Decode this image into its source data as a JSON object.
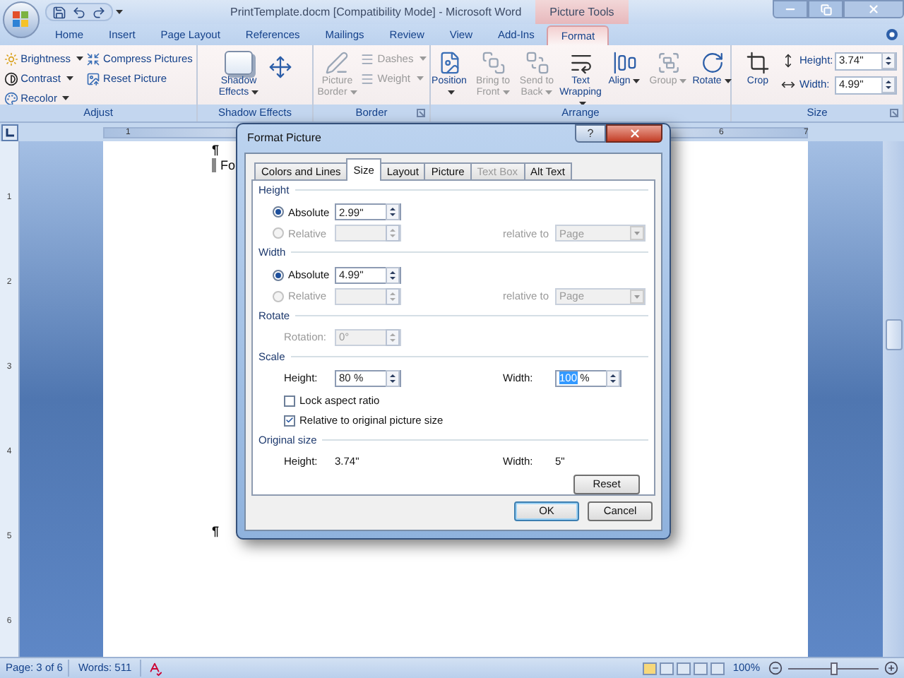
{
  "window": {
    "title": "PrintTemplate.docm [Compatibility Mode] - Microsoft Word",
    "context_label": "Picture Tools"
  },
  "tabs": [
    {
      "label": "Home",
      "selected": false
    },
    {
      "label": "Insert",
      "selected": false
    },
    {
      "label": "Page Layout",
      "selected": false
    },
    {
      "label": "References",
      "selected": false
    },
    {
      "label": "Mailings",
      "selected": false
    },
    {
      "label": "Review",
      "selected": false
    },
    {
      "label": "View",
      "selected": false
    },
    {
      "label": "Add-Ins",
      "selected": false
    },
    {
      "label": "Format",
      "selected": true
    }
  ],
  "ribbon": [
    {
      "label": "Adjust",
      "launcher": false,
      "columns": [
        [
          {
            "kind": "small",
            "label": "Brightness",
            "menu": true,
            "disabled": false
          },
          {
            "kind": "small",
            "label": "Contrast",
            "menu": true,
            "disabled": false
          },
          {
            "kind": "small",
            "label": "Recolor",
            "menu": true,
            "disabled": false
          }
        ],
        [
          {
            "kind": "small",
            "label": "Compress Pictures",
            "menu": false,
            "disabled": false
          },
          {
            "kind": "small",
            "label": "Reset Picture",
            "menu": false,
            "disabled": false
          }
        ]
      ]
    },
    {
      "label": "Shadow Effects",
      "launcher": false,
      "columns": [
        [
          {
            "kind": "large",
            "label": "Shadow Effects",
            "menu": true,
            "disabled": false
          }
        ],
        [
          {
            "kind": "nudge"
          }
        ]
      ]
    },
    {
      "label": "Border",
      "launcher": true,
      "columns": [
        [
          {
            "kind": "large",
            "label": "Picture Border",
            "menu": true,
            "disabled": true
          }
        ],
        [
          {
            "kind": "small",
            "label": "Dashes",
            "menu": true,
            "disabled": true
          },
          {
            "kind": "small",
            "label": "Weight",
            "menu": true,
            "disabled": true
          }
        ]
      ]
    },
    {
      "label": "Arrange",
      "launcher": false,
      "columns": [
        [
          {
            "kind": "large",
            "label": "Position",
            "menu": true,
            "disabled": false
          }
        ],
        [
          {
            "kind": "large",
            "label": "Bring to Front",
            "menu": true,
            "disabled": true
          }
        ],
        [
          {
            "kind": "large",
            "label": "Send to Back",
            "menu": true,
            "disabled": true
          }
        ],
        [
          {
            "kind": "large",
            "label": "Text Wrapping",
            "menu": true,
            "disabled": false
          }
        ],
        [
          {
            "kind": "large",
            "label": "Align",
            "menu": true,
            "disabled": false
          }
        ],
        [
          {
            "kind": "large",
            "label": "Group",
            "menu": true,
            "disabled": true
          }
        ],
        [
          {
            "kind": "large",
            "label": "Rotate",
            "menu": true,
            "disabled": false
          }
        ]
      ]
    },
    {
      "label": "Size",
      "launcher": true,
      "columns": [
        [
          {
            "kind": "large",
            "label": "Crop",
            "menu": false,
            "disabled": false
          }
        ],
        [
          {
            "kind": "spinner",
            "label": "Height:",
            "value": "3.74\""
          },
          {
            "kind": "spinner",
            "label": "Width:",
            "value": "4.99\""
          }
        ]
      ]
    }
  ],
  "ruler": {
    "horizontal": [
      "1",
      "6",
      "7"
    ],
    "vertical": [
      "1",
      "2",
      "3",
      "4",
      "5",
      "6"
    ]
  },
  "document": {
    "first_mark": "¶",
    "field_text": "Fo",
    "last_mark": "¶"
  },
  "dialog": {
    "title": "Format Picture",
    "help_label": "?",
    "tabs": [
      {
        "label": "Colors and Lines",
        "selected": false,
        "disabled": false
      },
      {
        "label": "Size",
        "selected": true,
        "disabled": false
      },
      {
        "label": "Layout",
        "selected": false,
        "disabled": false
      },
      {
        "label": "Picture",
        "selected": false,
        "disabled": false
      },
      {
        "label": "Text Box",
        "selected": false,
        "disabled": true
      },
      {
        "label": "Alt Text",
        "selected": false,
        "disabled": false
      }
    ],
    "sections": [
      {
        "kind": "size_block",
        "heading": "Height",
        "options": [
          {
            "label": "Absolute",
            "selected": true,
            "disabled": false,
            "value": "2.99\""
          },
          {
            "label": "Relative",
            "selected": false,
            "disabled": true,
            "relative_to": "relative to",
            "dropdown": "Page"
          }
        ]
      },
      {
        "kind": "size_block",
        "heading": "Width",
        "options": [
          {
            "label": "Absolute",
            "selected": true,
            "disabled": false,
            "value": "4.99\""
          },
          {
            "label": "Relative",
            "selected": false,
            "disabled": true,
            "relative_to": "relative to",
            "dropdown": "Page"
          }
        ]
      },
      {
        "kind": "rotate",
        "heading": "Rotate",
        "label": "Rotation:",
        "value": "0°",
        "disabled": true
      },
      {
        "kind": "scale",
        "heading": "Scale",
        "height": {
          "label": "Height:",
          "value": "80",
          "unit": "%",
          "highlighted": false
        },
        "width": {
          "label": "Width:",
          "value": "100",
          "unit": "%",
          "highlighted": true
        },
        "checkboxes": [
          {
            "label": "Lock aspect ratio",
            "checked": false
          },
          {
            "label": "Relative to original picture size",
            "checked": true
          }
        ]
      },
      {
        "kind": "original",
        "heading": "Original size",
        "height_label": "Height:",
        "height": "3.74\"",
        "width_label": "Width:",
        "width": "5\"",
        "reset": "Reset"
      }
    ],
    "buttons": [
      {
        "label": "OK",
        "default": true
      },
      {
        "label": "Cancel",
        "default": false
      }
    ]
  },
  "status_bar": {
    "page": "Page: 3 of 6",
    "words": "Words: 511",
    "zoom": "100%",
    "zoom_slider": {
      "level": 0.5
    }
  }
}
